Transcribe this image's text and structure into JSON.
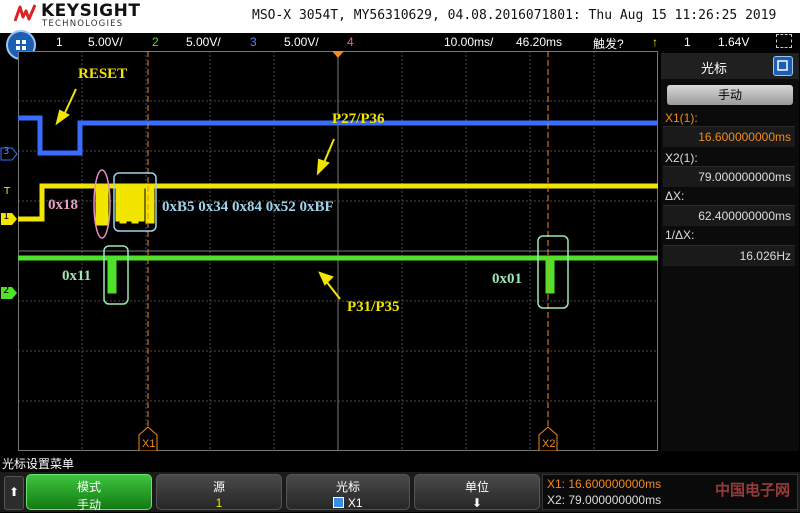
{
  "header": {
    "brand": "KEYSIGHT",
    "brand_sub": "TECHNOLOGIES",
    "scope_info": "MSO-X 3054T, MY56310629, 04.08.2016071801: Thu Aug 15 11:26:25 2019"
  },
  "channel_bar": {
    "ch1_num": "1",
    "ch1_scale": "5.00V/",
    "ch2_num": "2",
    "ch2_scale": "5.00V/",
    "ch3_num": "3",
    "ch3_scale": "5.00V/",
    "ch4_num": "4",
    "timebase": "10.00ms/",
    "delay": "46.20ms",
    "trigger_label": "触发?",
    "trigger_source": "1",
    "trigger_level": "1.64V",
    "colors": {
      "ch1": "#f2e600",
      "ch2": "#4fe22a",
      "ch3": "#3a6cff",
      "ch4": "#ff4fa8"
    }
  },
  "annotations": {
    "reset": "RESET",
    "p27_p36": "P27/P36",
    "p31_p35": "P31/P35",
    "hex_0x18": "0x18",
    "hex_sequence": "0xB5 0x34 0x84 0x52 0xBF",
    "hex_0x11": "0x11",
    "hex_0x01": "0x01"
  },
  "markers": {
    "x1_label": "X1",
    "x2_label": "X2",
    "ch3_ref": "3",
    "ch1_ref": "1",
    "ch2_ref": "2",
    "trig_ref": "T"
  },
  "cursor_panel": {
    "title": "光标",
    "mode_button": "手动",
    "x1_label": "X1(1):",
    "x1_value": "16.600000000ms",
    "x2_label": "X2(1):",
    "x2_value": "79.000000000ms",
    "dx_label": "ΔX:",
    "dx_value": "62.400000000ms",
    "inv_dx_label": "1/ΔX:",
    "inv_dx_value": "16.026Hz"
  },
  "softkeys": {
    "menu_title": "光标设置菜单",
    "mode_label": "模式",
    "mode_value": "手动",
    "source_label": "源",
    "source_value": "1",
    "cursor_label": "光标",
    "cursor_value": "X1",
    "units_label": "单位",
    "readout_x1": "X1: 16.600000000ms",
    "readout_x2": "X2: 79.000000000ms",
    "watermark": "中国电子网"
  }
}
